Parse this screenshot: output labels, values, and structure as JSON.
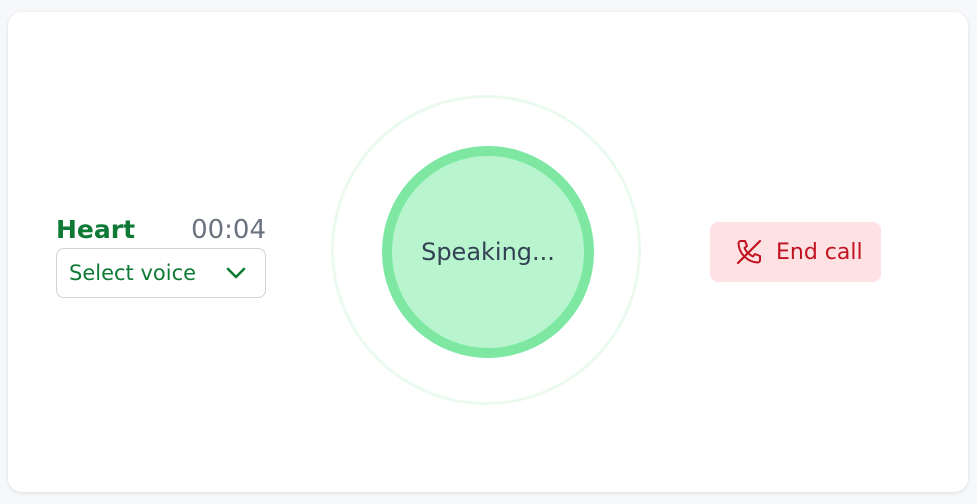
{
  "caller": {
    "voice_name": "Heart",
    "timer": "00:04"
  },
  "voice_select": {
    "selected": "Select voice",
    "icon": "chevron-down-icon"
  },
  "status": {
    "text": "Speaking..."
  },
  "end_call": {
    "label": "End call",
    "icon": "phone-off-icon"
  },
  "colors": {
    "accent_green": "#0f7a36",
    "orb_fill": "#b8f5cf",
    "orb_border": "#7ee8a2",
    "end_call_bg": "#fde1e3",
    "end_call_text": "#c0121f"
  }
}
